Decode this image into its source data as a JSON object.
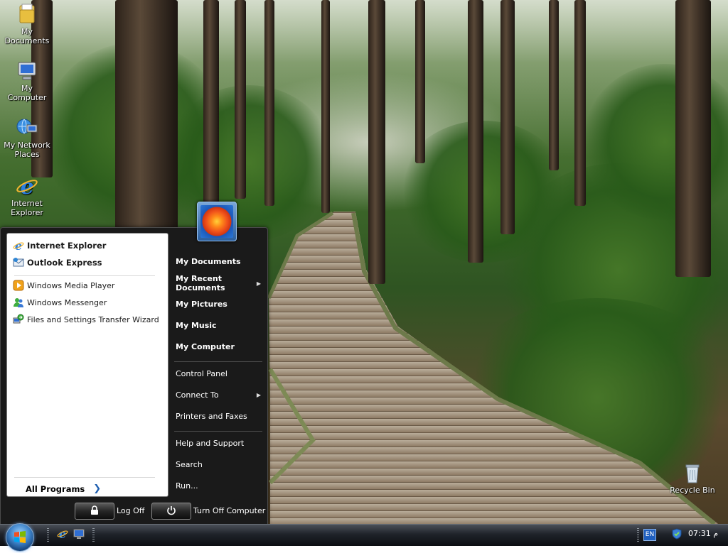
{
  "desktop": {
    "icons": [
      {
        "label": "My Documents"
      },
      {
        "label": "My Computer"
      },
      {
        "label": "My Network Places"
      },
      {
        "label": "Internet Explorer"
      },
      {
        "label": "Recycle Bin"
      }
    ]
  },
  "start_menu": {
    "pinned": [
      {
        "label": "Internet Explorer",
        "icon": "internet-explorer-icon"
      },
      {
        "label": "Outlook Express",
        "icon": "outlook-express-icon"
      }
    ],
    "recent_programs": [
      {
        "label": "Windows Media Player",
        "icon": "media-player-icon"
      },
      {
        "label": "Windows Messenger",
        "icon": "messenger-icon"
      },
      {
        "label": "Files and Settings Transfer Wizard",
        "icon": "transfer-wizard-icon"
      }
    ],
    "all_programs": "All Programs",
    "right_pane": [
      {
        "label": "My Documents",
        "bold": true
      },
      {
        "label": "My Recent Documents",
        "bold": true,
        "submenu": true
      },
      {
        "label": "My Pictures",
        "bold": true
      },
      {
        "label": "My Music",
        "bold": true
      },
      {
        "label": "My Computer",
        "bold": true
      },
      {
        "label": "Control Panel",
        "bold": false
      },
      {
        "label": "Connect To",
        "bold": false,
        "submenu": true
      },
      {
        "label": "Printers and Faxes",
        "bold": false
      },
      {
        "label": "Help and Support",
        "bold": false
      },
      {
        "label": "Search",
        "bold": false
      },
      {
        "label": "Run...",
        "bold": false
      }
    ],
    "log_off": "Log Off",
    "turn_off": "Turn Off Computer"
  },
  "taskbar": {
    "language": "EN",
    "clock": "07:31 م"
  },
  "colors": {
    "start_menu_bg": "#1a1a1a",
    "left_pane_bg": "#ffffff",
    "taskbar_bg": "#1f232a",
    "accent_blue": "#1f5fb0"
  }
}
